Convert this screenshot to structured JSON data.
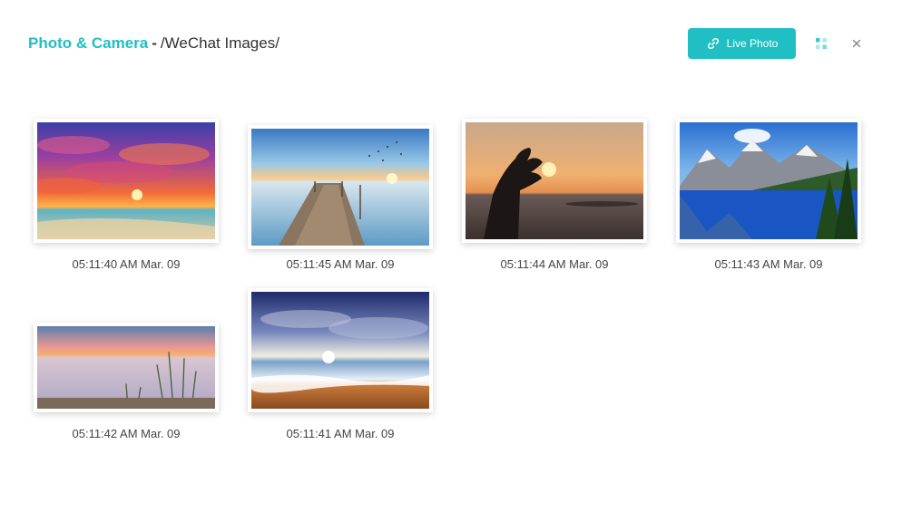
{
  "header": {
    "app_name": "Photo & Camera",
    "separator": "-",
    "path": "/WeChat Images/",
    "live_photo_label": "Live Photo"
  },
  "icons": {
    "live_photo": "link-icon",
    "view_toggle": "grid-view-icon",
    "close": "close-icon"
  },
  "colors": {
    "accent": "#1fbfc3"
  },
  "photos": [
    {
      "timestamp": "05:11:40 AM Mar. 09",
      "scene": "vivid purple and orange sunset clouds over beach"
    },
    {
      "timestamp": "05:11:45 AM Mar. 09",
      "scene": "wooden pier into calm lake at sunset with birds"
    },
    {
      "timestamp": "05:11:44 AM Mar. 09",
      "scene": "hand silhouette pinching the sun at dusk"
    },
    {
      "timestamp": "05:11:43 AM Mar. 09",
      "scene": "mountain lake reflection with pine trees"
    },
    {
      "timestamp": "05:11:42 AM Mar. 09",
      "scene": "lake sunset with reeds and wooden deck"
    },
    {
      "timestamp": "05:11:41 AM Mar. 09",
      "scene": "ocean waves on sandy beach under dramatic sky"
    }
  ]
}
